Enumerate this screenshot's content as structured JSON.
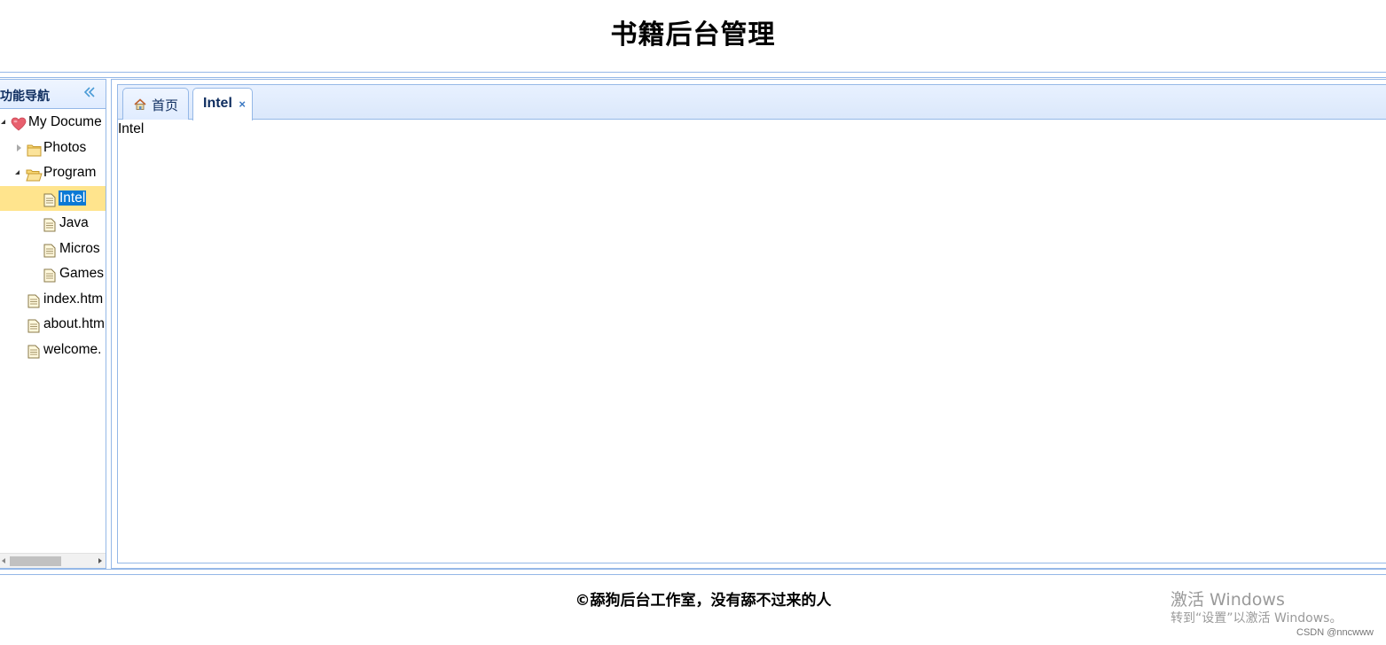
{
  "header": {
    "title": "书籍后台管理"
  },
  "west": {
    "title": "功能导航",
    "collapse_icon": "double-chevron-left-icon",
    "tree": [
      {
        "label": "My Documents",
        "visible_label": "My Docume",
        "icon": "heart-icon",
        "expanded": true,
        "level": 0
      },
      {
        "label": "Photos",
        "icon": "folder-icon",
        "expanded": false,
        "level": 1
      },
      {
        "label": "Program",
        "icon": "folder-open-icon",
        "expanded": true,
        "level": 1
      },
      {
        "label": "Intel",
        "icon": "file-icon",
        "level": 2,
        "selected": true
      },
      {
        "label": "Java",
        "icon": "file-icon",
        "level": 2
      },
      {
        "label": "Microsoft Office",
        "visible_label": "Micros",
        "icon": "file-icon",
        "level": 2
      },
      {
        "label": "Games",
        "icon": "file-icon",
        "level": 2
      },
      {
        "label": "index.html",
        "visible_label": "index.htm",
        "icon": "file-icon",
        "level": 1
      },
      {
        "label": "about.html",
        "visible_label": "about.htm",
        "icon": "file-icon",
        "level": 1
      },
      {
        "label": "welcome.html",
        "visible_label": "welcome.",
        "icon": "file-icon",
        "level": 1
      }
    ]
  },
  "tabs": [
    {
      "label": "首页",
      "icon": "home-icon",
      "active": false,
      "closable": false
    },
    {
      "label": "Intel",
      "active": true,
      "closable": true,
      "close_glyph": "×"
    }
  ],
  "content": {
    "text": "Intel"
  },
  "footer": {
    "text": "©舔狗后台工作室，没有舔不过来的人"
  },
  "watermark": {
    "title": "激活 Windows",
    "subtitle": "转到“设置”以激活 Windows。",
    "credit": "CSDN @nncwww"
  },
  "colors": {
    "border": "#95b8e7",
    "tab_bg": "#e0ecff",
    "selected_row": "#ffe48d",
    "selected_text_bg": "#0a79d5"
  }
}
